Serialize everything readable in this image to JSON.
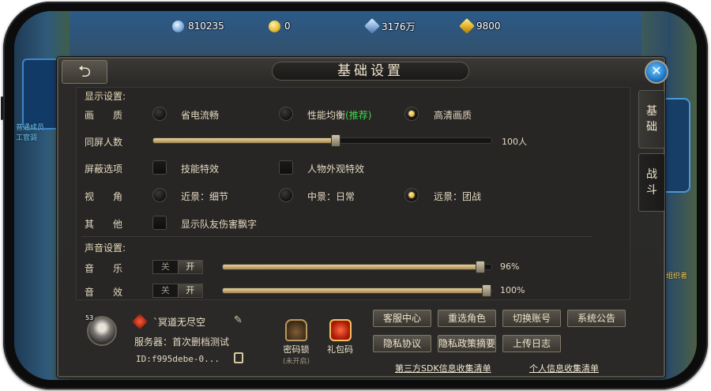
{
  "currency": {
    "diamond": "810235",
    "coins": "0",
    "crystal": "3176万",
    "gold": "9800"
  },
  "background": {
    "left_text_1": "普通成员",
    "left_text_2": "工官调",
    "right_text": "台组织者"
  },
  "dialog": {
    "title": "基础设置",
    "back_icon": "back-arrow-icon",
    "close_icon": "close-icon"
  },
  "tabs": [
    {
      "label": "基础",
      "active": true
    },
    {
      "label": "战斗",
      "active": false
    }
  ],
  "display": {
    "section_title": "显示设置:",
    "quality": {
      "label": "画　　质",
      "options": [
        "省电流畅",
        "性能均衡",
        "高清画质"
      ],
      "recommended": "(推荐)",
      "selected": 2
    },
    "same_screen": {
      "label": "同屏人数",
      "value_text": "100人",
      "level": 0.54
    },
    "shield": {
      "label": "屏蔽选项",
      "options": [
        "技能特效",
        "人物外观特效"
      ]
    },
    "view": {
      "label": "视　　角",
      "options": [
        "近景：细节",
        "中景：日常",
        "远景：团战"
      ],
      "selected": 2
    },
    "other": {
      "label": "其　　他",
      "option": "显示队友伤害飘字"
    }
  },
  "sound": {
    "section_title": "声音设置:",
    "music": {
      "label": "音　　乐",
      "off": "关",
      "on": "开",
      "value_text": "96%",
      "level": 0.96
    },
    "effects": {
      "label": "音　　效",
      "off": "关",
      "on": "开",
      "value_text": "100%",
      "level": 1.0
    }
  },
  "player": {
    "level": "53",
    "name": "`冥道无尽空",
    "server": "服务器：首次删档测试",
    "id": "ID:f995debe-0..."
  },
  "items": {
    "password_lock": {
      "label": "密码锁",
      "note": "(未开启)"
    },
    "gift_code": {
      "label": "礼包码"
    }
  },
  "buttons": {
    "customer_service": "客服中心",
    "reselect_role": "重选角色",
    "switch_account": "切换账号",
    "system_notice": "系统公告",
    "privacy_agreement": "隐私协议",
    "privacy_summary": "隐私政策摘要",
    "upload_log": "上传日志"
  },
  "links": {
    "third_party_sdk": "第三方SDK信息收集清单",
    "personal_info": "个人信息收集清单"
  }
}
